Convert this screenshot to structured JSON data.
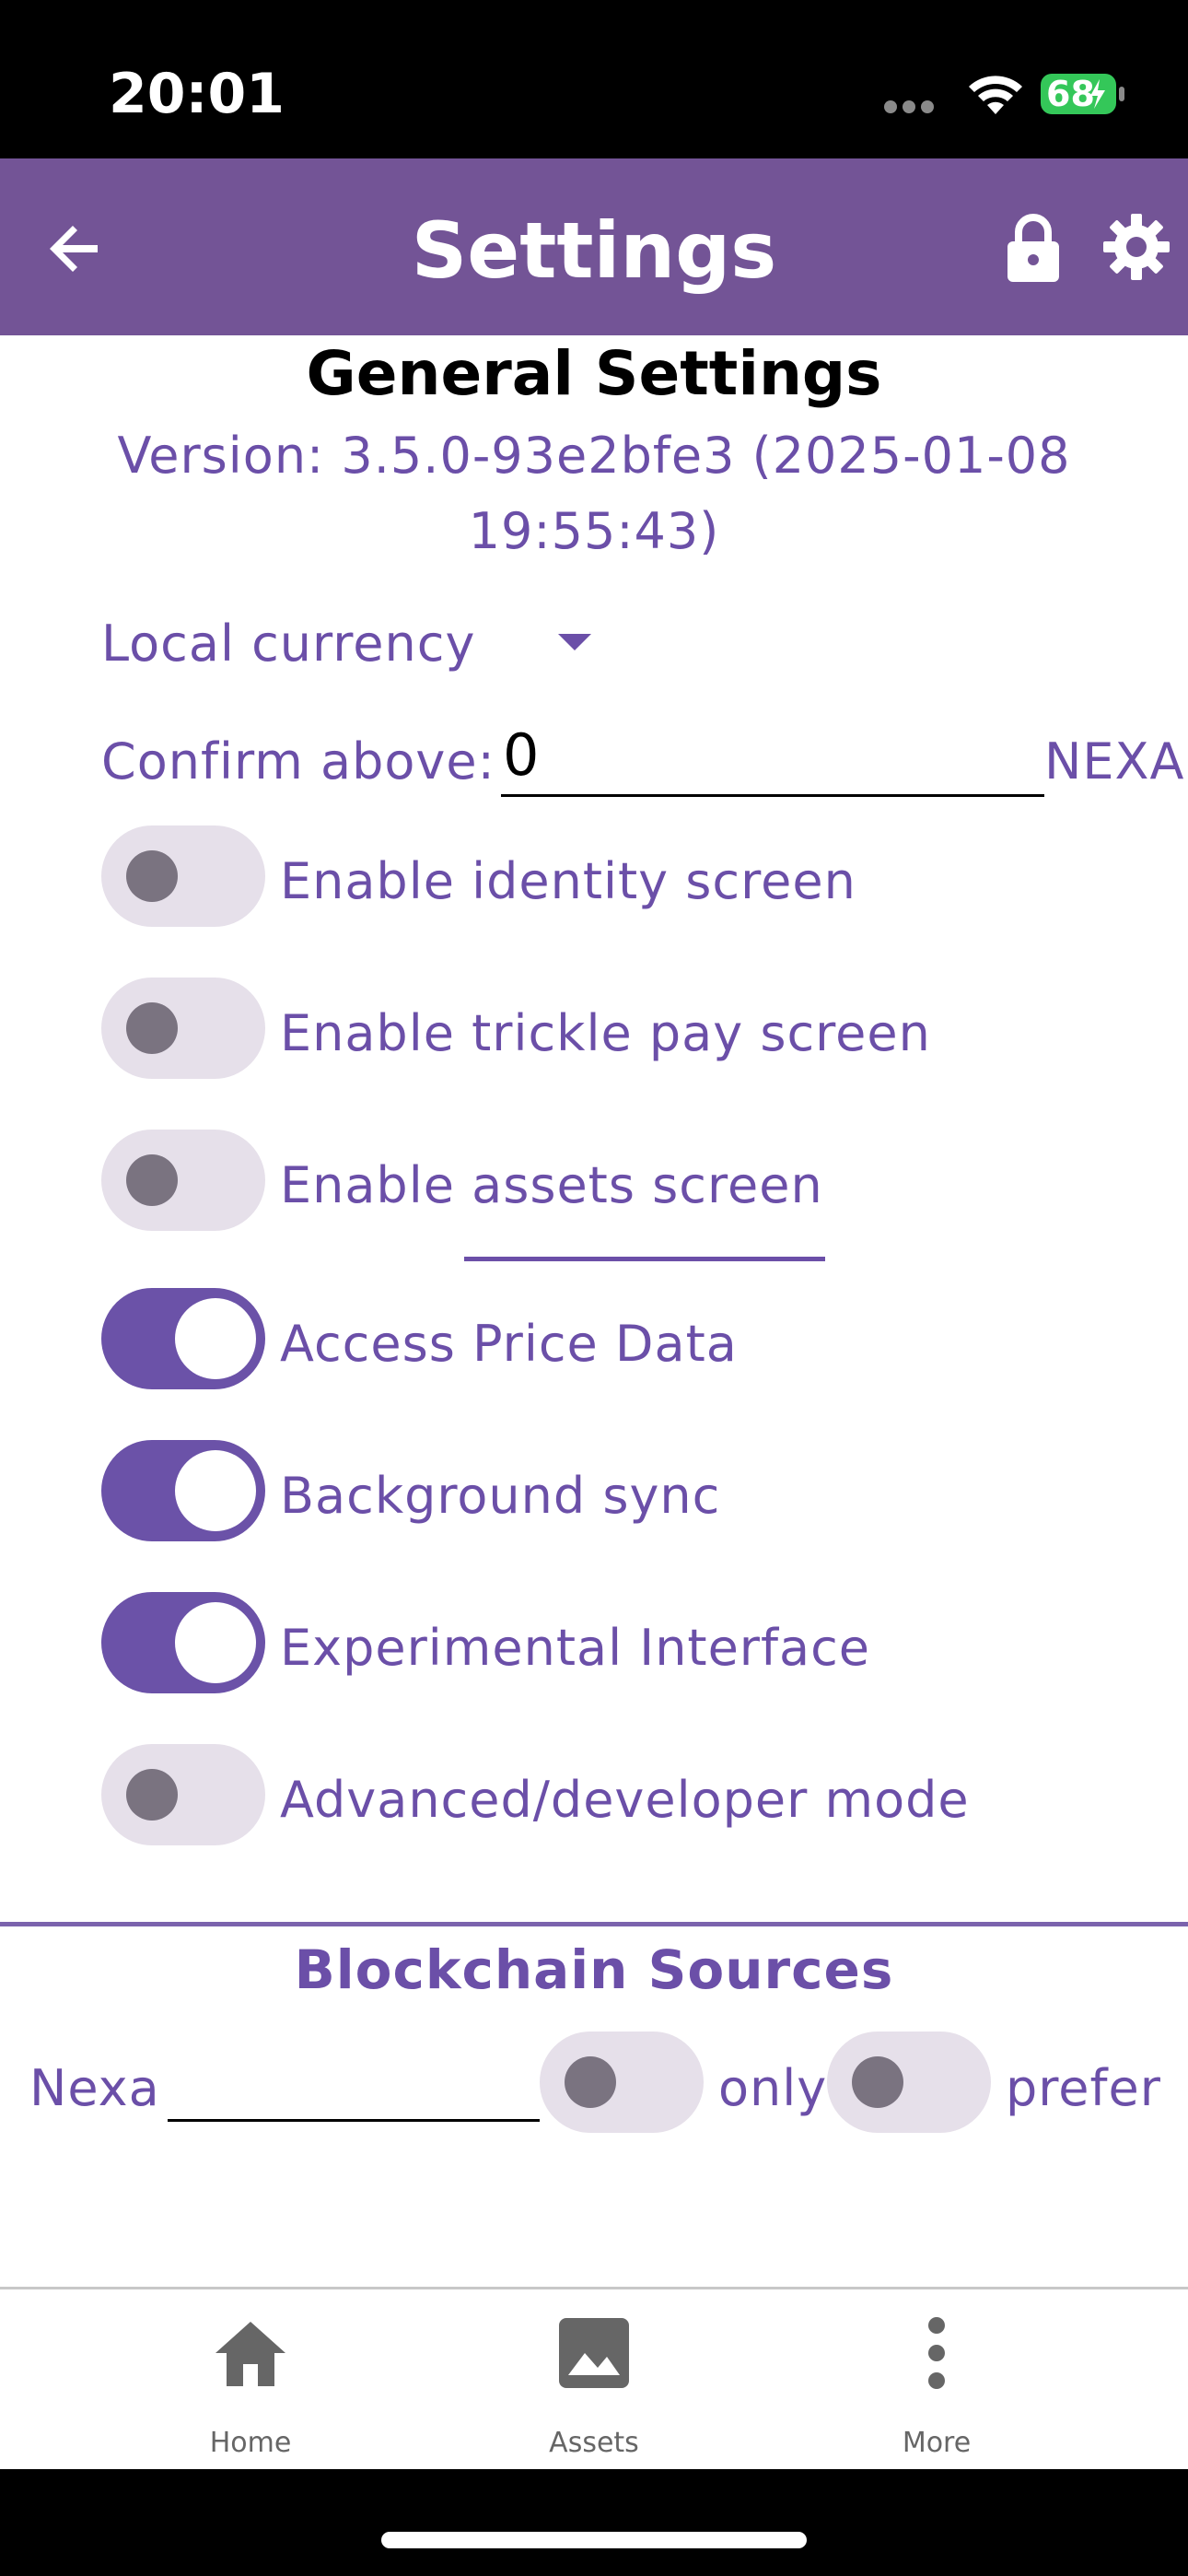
{
  "status_bar": {
    "time": "20:01",
    "battery": "68"
  },
  "app_bar": {
    "title": "Settings",
    "back_icon": "arrow-back-icon",
    "lock_icon": "lock-icon",
    "gear_icon": "gear-icon",
    "color": "#735496"
  },
  "general": {
    "title": "General Settings",
    "version": "Version: 3.5.0-93e2bfe3 (2025-01-08 19:55:43)",
    "local_currency_label": "Local currency",
    "confirm_above_label": "Confirm above:",
    "confirm_above_value": "0",
    "confirm_unit": "NEXA",
    "toggles": [
      {
        "label": "Enable identity screen",
        "on": false
      },
      {
        "label": "Enable trickle pay screen",
        "on": false
      },
      {
        "label": "Enable assets screen",
        "on": false
      },
      {
        "label": "Access Price Data",
        "on": true
      },
      {
        "label": "Background sync",
        "on": true
      },
      {
        "label": "Experimental Interface",
        "on": true
      },
      {
        "label": "Advanced/developer mode",
        "on": false
      }
    ]
  },
  "blockchain_sources": {
    "title": "Blockchain Sources",
    "chain_label": "Nexa",
    "source_value": "",
    "only_label": "only",
    "only_on": false,
    "prefer_label": "prefer",
    "prefer_on": false
  },
  "bottom_nav": {
    "items": [
      {
        "label": "Home",
        "icon": "home-icon"
      },
      {
        "label": "Assets",
        "icon": "image-icon"
      },
      {
        "label": "More",
        "icon": "more-vert-icon"
      }
    ]
  },
  "colors": {
    "accent": "#6b4fa8",
    "switch_on": "#6b52a8",
    "switch_off": "#e6e0ea"
  }
}
